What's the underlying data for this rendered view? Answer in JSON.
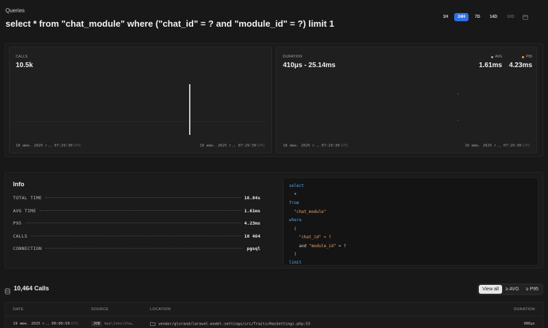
{
  "breadcrumb": "Queries",
  "query_title": "select * from \"chat_module\" where (\"chat_id\" = ? and \"module_id\" = ?) limit 1",
  "periods": [
    {
      "label": "1H",
      "state": "normal"
    },
    {
      "label": "24H",
      "state": "active"
    },
    {
      "label": "7D",
      "state": "normal"
    },
    {
      "label": "14D",
      "state": "normal"
    },
    {
      "label": "30D",
      "state": "disabled"
    }
  ],
  "calls_card": {
    "label": "CALLS",
    "value": "10.5k",
    "start": "18 июн. 2025 г., 07:29:30",
    "end": "19 июн. 2025 г., 07:29:30",
    "tz": "UTC"
  },
  "duration_card": {
    "label": "DURATION",
    "value": "410μs - 25.14ms",
    "legend_avg_label": "AVG",
    "legend_p95_label": "P95",
    "avg_value": "1.61ms",
    "p95_value": "4.23ms",
    "start": "18 июн. 2025 г., 07:29:30",
    "end": "19 июн. 2025 г., 07:29:30",
    "tz": "UTC"
  },
  "info": {
    "title": "Info",
    "rows": [
      {
        "key": "TOTAL TIME",
        "value": "16.84s"
      },
      {
        "key": "AVG TIME",
        "value": "1.61ms"
      },
      {
        "key": "P95",
        "value": "4.23ms"
      },
      {
        "key": "CALLS",
        "value": "10 464"
      },
      {
        "key": "CONNECTION",
        "value": "pgsql"
      }
    ]
  },
  "sql_lines": [
    {
      "indent": "",
      "text": "select",
      "kind": "kw"
    },
    {
      "indent": "  ",
      "text": "*",
      "kind": "plain"
    },
    {
      "indent": "",
      "text": "from",
      "kind": "kw"
    },
    {
      "indent": "  ",
      "text": "\"chat_module\"",
      "kind": "str"
    },
    {
      "indent": "",
      "text": "where",
      "kind": "kw"
    },
    {
      "indent": "  ",
      "text": "(",
      "kind": "plain"
    },
    {
      "indent": "    ",
      "text": "\"chat_id\" = ?",
      "kind": "str"
    },
    {
      "indent": "    ",
      "text": "and \"module_id\" = ?",
      "kind": "mixed"
    },
    {
      "indent": "  ",
      "text": ")",
      "kind": "plain"
    },
    {
      "indent": "",
      "text": "limit",
      "kind": "kw"
    }
  ],
  "calls_list": {
    "title": "10,464 Calls",
    "filters": [
      {
        "label": "View all",
        "active": true
      },
      {
        "label": "≥ AVG",
        "active": false
      },
      {
        "label": "≥ P95",
        "active": false
      }
    ],
    "columns": [
      "DATE",
      "SOURCE",
      "LOCATION",
      "DURATION"
    ],
    "rows": [
      {
        "date": "19 июн. 2025 г., 00:00:50",
        "tz": "UTC",
        "source_badge": "JOB",
        "source_path": "App\\Jobs\\Cha…",
        "location": "vendor/glorand/laravel-model-settings/src/Traits/HasSettings.php:53",
        "duration": "980μs"
      }
    ]
  },
  "colors": {
    "accent": "#2f6fe6",
    "avg_dot": "#9a9a9a",
    "p95_dot": "#e88a2a",
    "sql_keyword": "#5aa7e8",
    "sql_string": "#e8a76a"
  }
}
